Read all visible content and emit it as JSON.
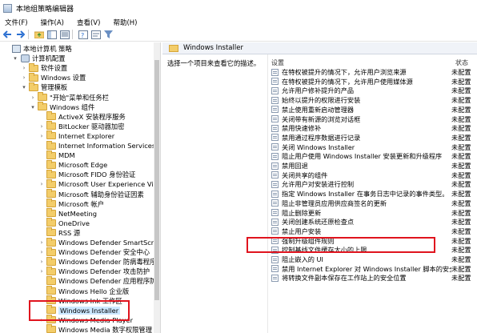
{
  "window": {
    "title": "本地组策略编辑器"
  },
  "menu": [
    "文件(F)",
    "操作(A)",
    "查看(V)",
    "帮助(H)"
  ],
  "toolbar": [
    "back-icon",
    "forward-icon",
    "up-folder-icon",
    "show-tree-icon",
    "export-icon",
    "help-icon",
    "properties-icon",
    "filter-icon"
  ],
  "tree": [
    {
      "label": "本地计算机 策略",
      "level": 0,
      "arrow": "",
      "icon": "root"
    },
    {
      "label": "计算机配置",
      "level": 1,
      "arrow": "▾",
      "icon": "cfg"
    },
    {
      "label": "软件设置",
      "level": 2,
      "arrow": "›",
      "icon": "folder"
    },
    {
      "label": "Windows 设置",
      "level": 2,
      "arrow": "›",
      "icon": "folder"
    },
    {
      "label": "管理模板",
      "level": 2,
      "arrow": "▾",
      "icon": "folder"
    },
    {
      "label": "\"开始\"菜单和任务栏",
      "level": 3,
      "arrow": "›",
      "icon": "folder"
    },
    {
      "label": "Windows 组件",
      "level": 3,
      "arrow": "▾",
      "icon": "folder"
    },
    {
      "label": "ActiveX 安装程序服务",
      "level": 4,
      "arrow": "",
      "icon": "folder"
    },
    {
      "label": "BitLocker 驱动器加密",
      "level": 4,
      "arrow": "›",
      "icon": "folder"
    },
    {
      "label": "Internet Explorer",
      "level": 4,
      "arrow": "›",
      "icon": "folder"
    },
    {
      "label": "Internet Information Services",
      "level": 4,
      "arrow": "",
      "icon": "folder"
    },
    {
      "label": "MDM",
      "level": 4,
      "arrow": "",
      "icon": "folder"
    },
    {
      "label": "Microsoft Edge",
      "level": 4,
      "arrow": "",
      "icon": "folder"
    },
    {
      "label": "Microsoft FIDO 身份验证",
      "level": 4,
      "arrow": "",
      "icon": "folder"
    },
    {
      "label": "Microsoft User Experience Virtualiz",
      "level": 4,
      "arrow": "›",
      "icon": "folder"
    },
    {
      "label": "Microsoft 辅助身份验证因素",
      "level": 4,
      "arrow": "",
      "icon": "folder"
    },
    {
      "label": "Microsoft 帐户",
      "level": 4,
      "arrow": "",
      "icon": "folder"
    },
    {
      "label": "NetMeeting",
      "level": 4,
      "arrow": "",
      "icon": "folder"
    },
    {
      "label": "OneDrive",
      "level": 4,
      "arrow": "",
      "icon": "folder"
    },
    {
      "label": "RSS 源",
      "level": 4,
      "arrow": "",
      "icon": "folder"
    },
    {
      "label": "Windows Defender SmartScreen",
      "level": 4,
      "arrow": "›",
      "icon": "folder"
    },
    {
      "label": "Windows Defender 安全中心",
      "level": 4,
      "arrow": "›",
      "icon": "folder"
    },
    {
      "label": "Windows Defender 防病毒程序",
      "level": 4,
      "arrow": "›",
      "icon": "folder"
    },
    {
      "label": "Windows Defender 攻击防护",
      "level": 4,
      "arrow": "›",
      "icon": "folder"
    },
    {
      "label": "Windows Defender 应用程序防护",
      "level": 4,
      "arrow": "",
      "icon": "folder"
    },
    {
      "label": "Windows Hello 企业版",
      "level": 4,
      "arrow": "",
      "icon": "folder"
    },
    {
      "label": "Windows Ink 工作区",
      "level": 4,
      "arrow": "",
      "icon": "folder"
    },
    {
      "label": "Windows Installer",
      "level": 4,
      "arrow": "",
      "icon": "folder",
      "selected": true
    },
    {
      "label": "Windows Media Player",
      "level": 4,
      "arrow": "›",
      "icon": "folder"
    },
    {
      "label": "Windows Media 数字权限管理",
      "level": 4,
      "arrow": "",
      "icon": "folder"
    }
  ],
  "details": {
    "header": "Windows Installer",
    "description": "选择一个项目来查看它的描述。",
    "col_setting": "设置",
    "col_state": "状态",
    "policies": [
      {
        "name": "在特权被提升的情况下，允许用户浏览来源",
        "state": "未配置"
      },
      {
        "name": "在特权被提升的情况下，允许用户使用媒体源",
        "state": "未配置"
      },
      {
        "name": "允许用户修补提升的产品",
        "state": "未配置"
      },
      {
        "name": "始终以提升的权限进行安装",
        "state": "未配置"
      },
      {
        "name": "禁止使用重新启动管理器",
        "state": "未配置"
      },
      {
        "name": "关闭带有新源的浏览对话框",
        "state": "未配置"
      },
      {
        "name": "禁用快速修补",
        "state": "未配置"
      },
      {
        "name": "禁用通过程序数据进行记录",
        "state": "未配置"
      },
      {
        "name": "关闭 Windows Installer",
        "state": "未配置"
      },
      {
        "name": "阻止用户使用 Windows Installer 安装更新和升级程序",
        "state": "未配置"
      },
      {
        "name": "禁用回退",
        "state": "未配置"
      },
      {
        "name": "关闭共享的组件",
        "state": "未配置"
      },
      {
        "name": "允许用户对安装进行控制",
        "state": "未配置"
      },
      {
        "name": "指定 Windows Installer 在事务日志中记录的事件类型。",
        "state": "未配置"
      },
      {
        "name": "阻止非管理员应用供应商签名的更新",
        "state": "未配置"
      },
      {
        "name": "阻止删除更新",
        "state": "未配置"
      },
      {
        "name": "关闭创建系统还原检查点",
        "state": "未配置"
      },
      {
        "name": "禁止用户安装",
        "state": "未配置"
      },
      {
        "name": "强制升级组件规则",
        "state": "未配置"
      },
      {
        "name": "控制基线文件缓存大小的上限",
        "state": "未配置"
      },
      {
        "name": "阻止嵌入的 UI",
        "state": "未配置"
      },
      {
        "name": "禁用 Internet Explorer 对 Windows Installer 脚本的安全...",
        "state": "未配置"
      },
      {
        "name": "将转换文件副本保存在工作站上的安全位置",
        "state": "未配置"
      }
    ]
  }
}
